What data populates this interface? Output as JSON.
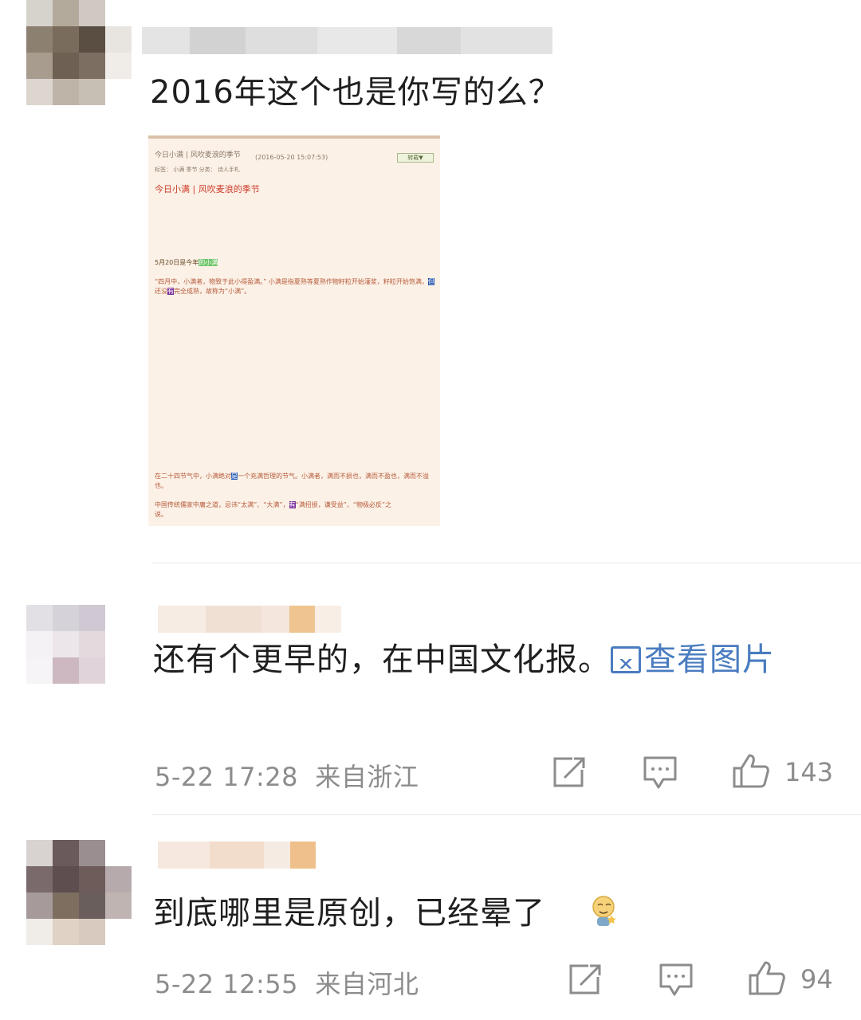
{
  "comments": [
    {
      "text": "2016年这个也是你写的么？",
      "image": {
        "post_title": "今日小满 | 风吹麦浪的季节",
        "post_time": "(2016-05-20 15:07:53)",
        "button": "转载▼",
        "tags_line": "标签：  小满    季节    分类：  诗人手札",
        "heading": "今日小满 | 风吹麦浪的季节",
        "line1_prefix": "5月20日",
        "line1_mid": "是今年",
        "line1_hl": "的小满",
        "para1_a": "“四月中，小满者，物致于此小得盈满。” 小满",
        "para1_hl": "是",
        "para1_b": "指夏熟等夏熟作物籽粒开始灌浆，籽粒开始饱满，",
        "para1_end": "但",
        "para2_a": "还没",
        "para2_hl": "有",
        "para2_b": "完全成熟，故称为“小满”。",
        "para3_a": "在二十四节气中，小满绝对",
        "para3_hl": "是",
        "para3_b": "一个充满哲理的节气。小满者，满而不损也，满而不盈也，满而不溢",
        "para3_c": "也。",
        "para4_a": "中国传统儒家中庸之道，忌讳“太满”、“大满”，",
        "para4_hl": "有",
        "para4_b": "“满招损，谦受益”、“物极必反”之",
        "para4_c": "说。"
      }
    },
    {
      "text": "还有个更早的，在中国文化报。",
      "link_text": "查看图片",
      "time": "5-22 17:28",
      "location": "来自浙江",
      "likes": "143"
    },
    {
      "text": "到底哪里是原创，已经晕了",
      "emoji": "dizzy-emoji",
      "time": "5-22 12:55",
      "location": "来自河北",
      "likes": "94"
    }
  ],
  "icons": {
    "repost": "repost-icon",
    "comment": "comment-icon",
    "like": "thumbs-up-icon",
    "picture": "picture-icon"
  },
  "colors": {
    "link": "#4a7cc0",
    "meta": "#8c8c8c",
    "text": "#1f1f1f"
  }
}
